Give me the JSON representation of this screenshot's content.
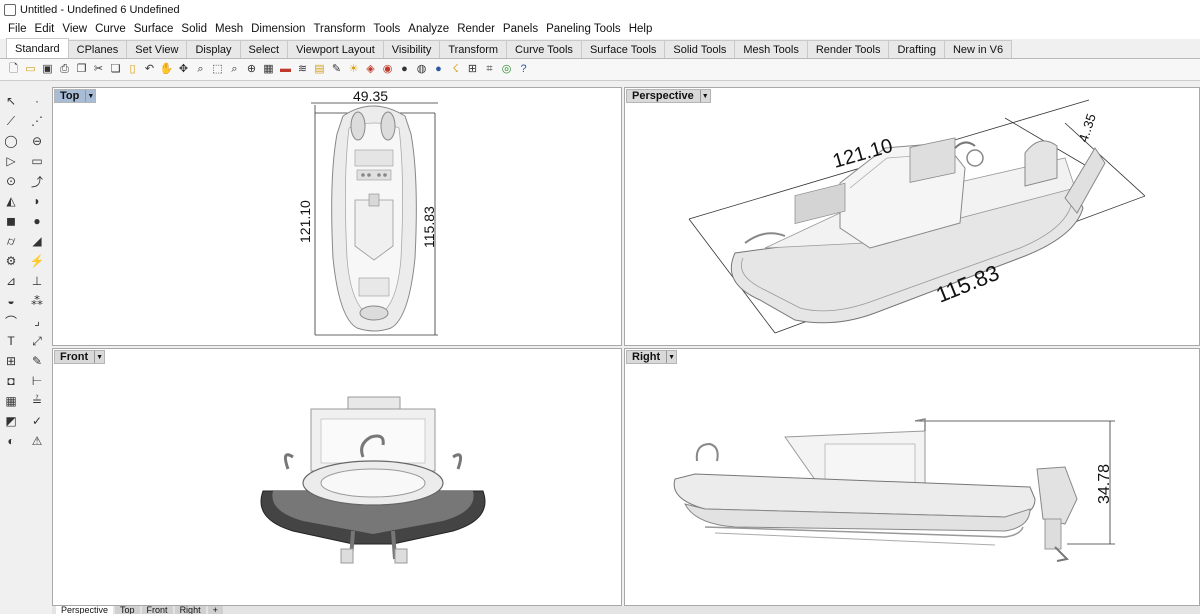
{
  "window": {
    "title": "Untitled - Undefined 6 Undefined"
  },
  "menu": [
    "File",
    "Edit",
    "View",
    "Curve",
    "Surface",
    "Solid",
    "Mesh",
    "Dimension",
    "Transform",
    "Tools",
    "Analyze",
    "Render",
    "Panels",
    "Paneling Tools",
    "Help"
  ],
  "tabs": [
    "Standard",
    "CPlanes",
    "Set View",
    "Display",
    "Select",
    "Viewport Layout",
    "Visibility",
    "Transform",
    "Curve Tools",
    "Surface Tools",
    "Solid Tools",
    "Mesh Tools",
    "Render Tools",
    "Drafting",
    "New in V6"
  ],
  "active_tab": "Standard",
  "toolbar_icons": [
    "new-file-icon",
    "open-folder-icon",
    "save-icon",
    "print-icon",
    "import-icon",
    "cut-icon",
    "copy-icon",
    "paste-icon",
    "undo-icon",
    "pan-hand-icon",
    "rotate-view-icon",
    "zoom-window-icon",
    "zoom-extents-icon",
    "zoom-selected-icon",
    "zoom-icon",
    "grid-icon",
    "car-icon",
    "layer-icon",
    "properties-icon",
    "paint-icon",
    "light-bulb-icon",
    "material-icon",
    "display-mode-icon",
    "render-sphere-icon",
    "shaded-sphere-icon",
    "render-icon",
    "lock-icon",
    "snap-icon",
    "grid-snap-icon",
    "globe-icon",
    "help-icon"
  ],
  "viewports": {
    "top": {
      "label": "Top",
      "dims": {
        "width": "49.35",
        "length_outer": "121.10",
        "length_inner": "115.83"
      }
    },
    "perspective": {
      "label": "Perspective",
      "dims": {
        "length_outer": "121.10",
        "length_inner": "115.83",
        "width_partial": "4..35"
      }
    },
    "front": {
      "label": "Front"
    },
    "right": {
      "label": "Right",
      "dims": {
        "height": "34.78"
      }
    }
  },
  "bottom_tabs": [
    "Perspective",
    "Top",
    "Front",
    "Right",
    "+"
  ]
}
